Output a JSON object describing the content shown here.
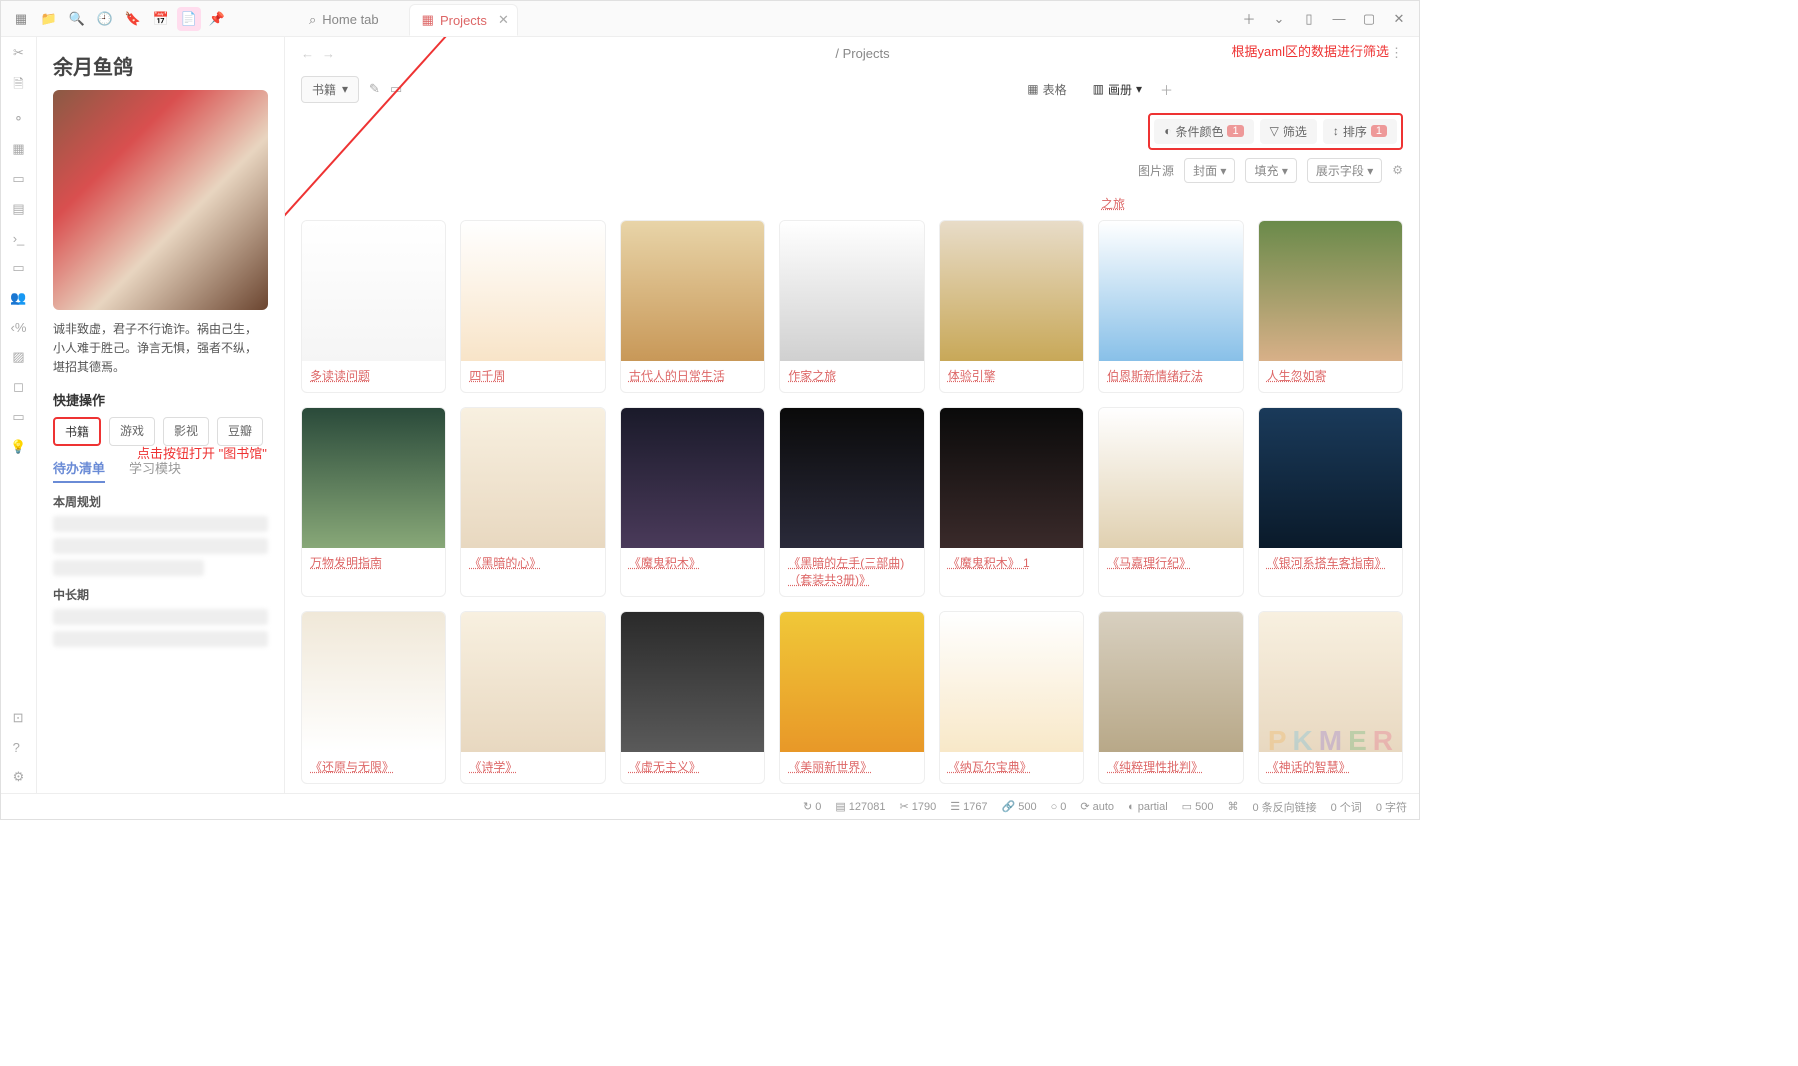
{
  "tabs": {
    "home": "Home tab",
    "projects": "Projects"
  },
  "breadcrumb": "/ Projects",
  "sidebar": {
    "username": "余月鱼鸽",
    "quote": "诚非致虚，君子不行诡诈。祸由己生，小人难于胜己。诤言无惧，强者不纵，堪招其德焉。",
    "quick_label": "快捷操作",
    "quick_btns": {
      "books": "书籍",
      "games": "游戏",
      "film": "影视",
      "douban": "豆瓣"
    },
    "side_tabs": {
      "todo": "待办清单",
      "study": "学习模块"
    },
    "plan_week": "本周规划",
    "plan_long": "中长期"
  },
  "toolbar": {
    "dropdown": "书籍",
    "view_table": "表格",
    "view_gallery": "画册"
  },
  "filters": {
    "color": "条件颜色",
    "color_count": "1",
    "filter": "筛选",
    "sort": "排序",
    "sort_count": "1"
  },
  "options": {
    "img_src_label": "图片源",
    "img_src_val": "封面",
    "fill": "填充",
    "fields": "展示字段"
  },
  "annotations": {
    "left": "点击按钮打开 \"图书馆\"",
    "right": "根据yaml区的数据进行筛选"
  },
  "stub_link": "之旅",
  "books": [
    {
      "title": "多读读问题",
      "cv": "cv1"
    },
    {
      "title": "四千周",
      "cv": "cv2"
    },
    {
      "title": "古代人的日常生活",
      "cv": "cv3"
    },
    {
      "title": "作家之旅",
      "cv": "cv4"
    },
    {
      "title": "体验引擎",
      "cv": "cv5"
    },
    {
      "title": "伯恩斯新情绪疗法",
      "cv": "cv6"
    },
    {
      "title": "人生忽如寄",
      "cv": "cv7"
    },
    {
      "title": "万物发明指南",
      "cv": "cv8"
    },
    {
      "title": "《黑暗的心》",
      "cv": "cv9"
    },
    {
      "title": "《魔鬼积木》",
      "cv": "cv10"
    },
    {
      "title": "《黑暗的左手(三部曲)（套装共3册)》",
      "cv": "cv11"
    },
    {
      "title": "《魔鬼积木》 1",
      "cv": "cv12"
    },
    {
      "title": "《马嘉理行纪》",
      "cv": "cv13"
    },
    {
      "title": "《银河系搭车客指南》",
      "cv": "cv14"
    },
    {
      "title": "《还原与无限》",
      "cv": "cv15"
    },
    {
      "title": "《诗学》",
      "cv": "cv9"
    },
    {
      "title": "《虚无主义》",
      "cv": "cv16"
    },
    {
      "title": "《美丽新世界》",
      "cv": "cv17"
    },
    {
      "title": "《纳瓦尔宝典》",
      "cv": "cv18"
    },
    {
      "title": "《纯粹理性批判》",
      "cv": "cv19"
    },
    {
      "title": "《神话的智慧》",
      "cv": "cv20"
    },
    {
      "title": "",
      "cv": "cv21"
    },
    {
      "title": "",
      "cv": "cv22"
    },
    {
      "title": "",
      "cv": "cv23"
    },
    {
      "title": "",
      "cv": "cv24"
    },
    {
      "title": "",
      "cv": "cv25"
    }
  ],
  "status": {
    "s0": "0",
    "files": "127081",
    "chars": "1790",
    "words": "1767",
    "link": "500",
    "zero": "0",
    "auto": "auto",
    "partial": "partial",
    "backlinks": "0 条反向链接",
    "wordcount": "0 个词",
    "charcount": "0 字符"
  },
  "watermark": "PKMER"
}
